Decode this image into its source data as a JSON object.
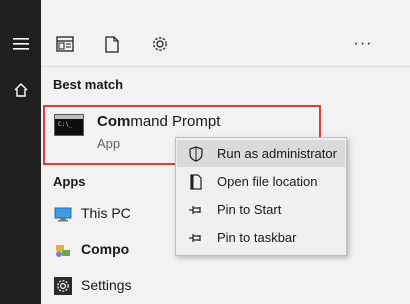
{
  "toolbar": {
    "icons": [
      "documents-icon",
      "file-icon",
      "settings-gear-icon"
    ],
    "more_label": "···"
  },
  "best_match": {
    "heading": "Best match",
    "title_bold": "Com",
    "title_rest": "mand Prompt",
    "subtitle": "App"
  },
  "apps": {
    "heading": "Apps",
    "items": [
      {
        "label": "This PC",
        "icon": "computer-icon"
      },
      {
        "label_bold": "Compo",
        "label_rest": "",
        "icon": "component-icon"
      },
      {
        "label": "Settings",
        "icon": "settings-icon"
      }
    ]
  },
  "context_menu": {
    "items": [
      {
        "label": "Run as administrator",
        "icon": "shield-icon",
        "highlighted": true
      },
      {
        "label": "Open file location",
        "icon": "file-location-icon"
      },
      {
        "label": "Pin to Start",
        "icon": "pin-icon"
      },
      {
        "label": "Pin to taskbar",
        "icon": "pin-icon"
      }
    ]
  },
  "colors": {
    "highlight_border": "#e23a3a",
    "rail_background": "#1f1f1f"
  }
}
